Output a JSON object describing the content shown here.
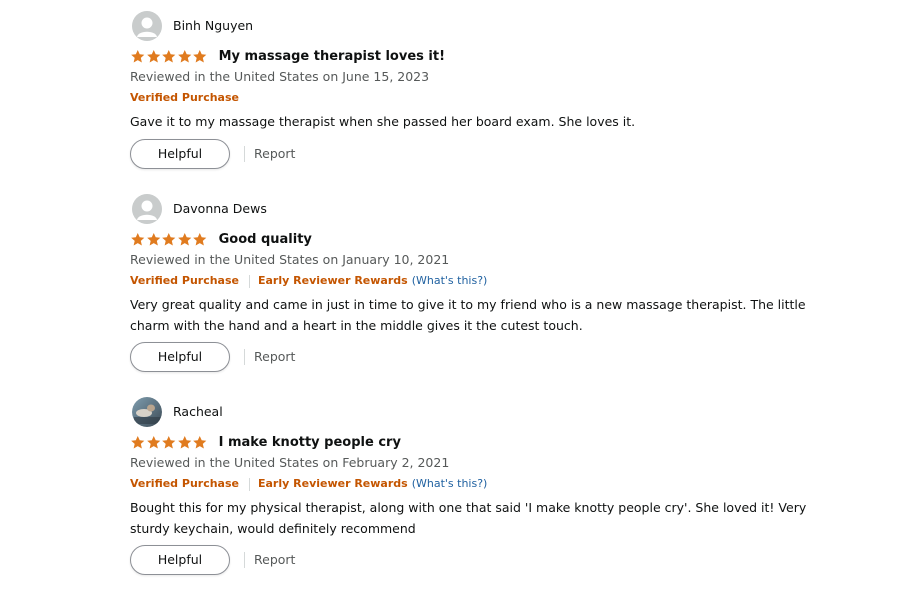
{
  "colors": {
    "star": "#e07b1f",
    "verified": "#c45500",
    "link": "#2162a1",
    "muted": "#565959",
    "text": "#0f1111"
  },
  "reviews": [
    {
      "reviewer": "Binh Nguyen",
      "avatar_icon": "default-person-icon",
      "rating": 5,
      "title": "My massage therapist loves it!",
      "date_text": "Reviewed in the United States on June 15, 2023",
      "verified": "Verified Purchase",
      "body": "Gave it to my massage therapist when she passed her board exam. She loves it.",
      "helpful_label": "Helpful",
      "report_label": "Report"
    },
    {
      "reviewer": "Davonna Dews",
      "avatar_icon": "default-person-icon",
      "rating": 5,
      "title": "Good quality",
      "date_text": "Reviewed in the United States on January 10, 2021",
      "verified": "Verified Purchase",
      "early_reviewer": "Early Reviewer Rewards",
      "whats_this": "(What's this?)",
      "body": "Very great quality and came in just in time to give it to my friend who is a new massage therapist. The little charm with the hand and a heart in the middle gives it the cutest touch.",
      "helpful_label": "Helpful",
      "report_label": "Report"
    },
    {
      "reviewer": "Racheal",
      "avatar_icon": "user-photo-avatar",
      "rating": 5,
      "title": "I make knotty people cry",
      "date_text": "Reviewed in the United States on February 2, 2021",
      "verified": "Verified Purchase",
      "early_reviewer": "Early Reviewer Rewards",
      "whats_this": "(What's this?)",
      "body": "Bought this for my physical therapist, along with one that said 'I make knotty people cry'. She loved it! Very sturdy keychain, would definitely recommend",
      "helpful_label": "Helpful",
      "report_label": "Report"
    }
  ]
}
